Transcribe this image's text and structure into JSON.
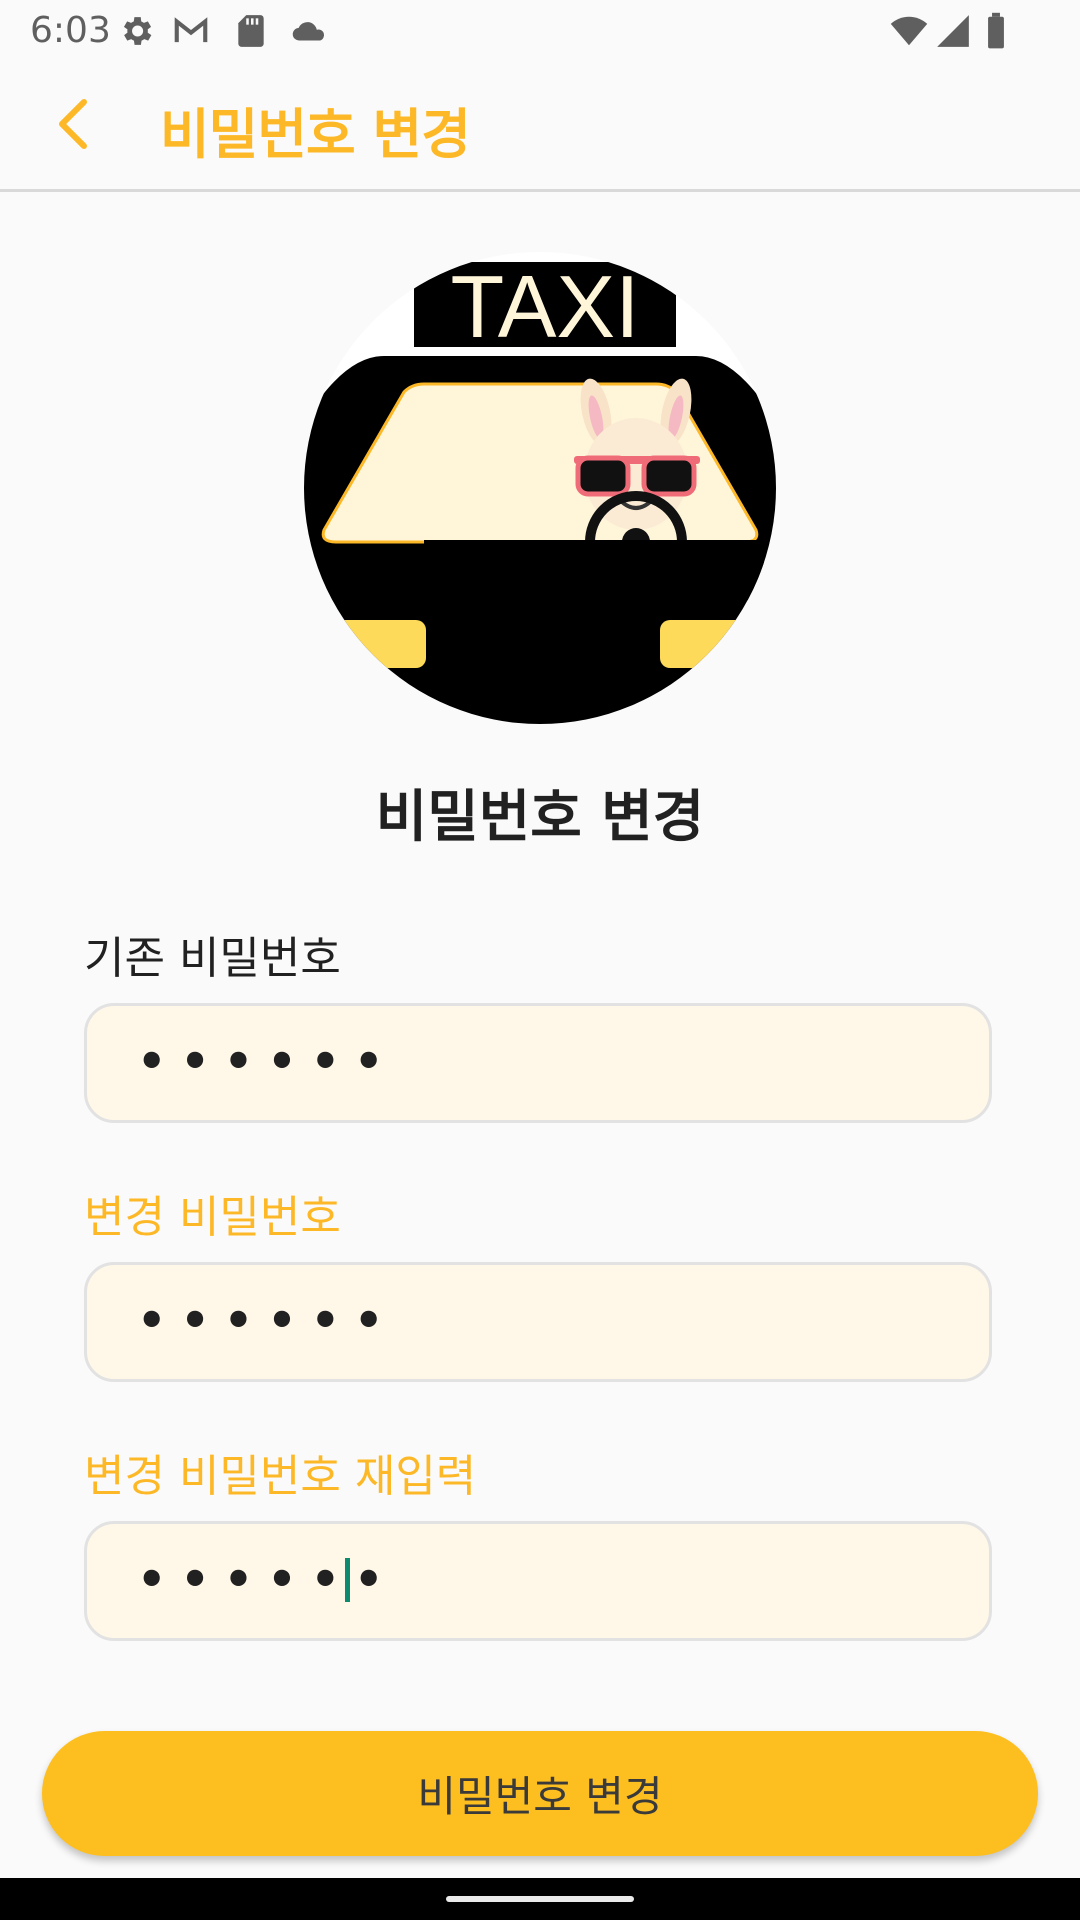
{
  "status_bar": {
    "time": "6:03",
    "icons": [
      "settings-icon",
      "gmail-icon",
      "sd-card-icon",
      "cloud-icon",
      "wifi-icon",
      "signal-icon",
      "battery-icon"
    ]
  },
  "app_bar": {
    "title": "비밀번호 변경",
    "back_icon": "chevron-left-icon"
  },
  "avatar": {
    "sign_text": "TAXI"
  },
  "heading": "비밀번호 변경",
  "form": {
    "current_password": {
      "label": "기존 비밀번호",
      "value": "••••••"
    },
    "new_password": {
      "label": "변경 비밀번호",
      "value": "••••••"
    },
    "confirm_password": {
      "label": "변경 비밀번호 재입력",
      "value": "••••••"
    }
  },
  "submit_button": {
    "label": "비밀번호 변경"
  },
  "colors": {
    "accent": "#FDB827",
    "button": "#FDBE20",
    "field_bg": "#FFF8E8",
    "cursor": "#0E8A6F"
  }
}
